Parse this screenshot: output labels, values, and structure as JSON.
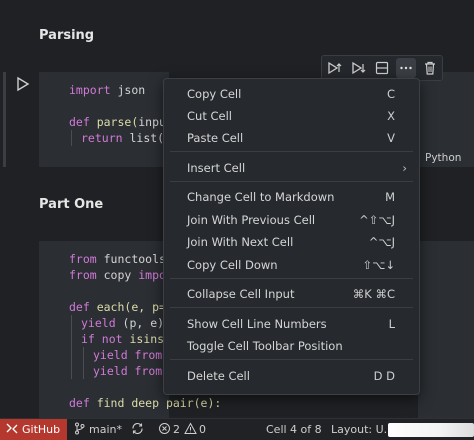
{
  "sections": {
    "parsing_title": "Parsing",
    "part_one_title": "Part One"
  },
  "cell1": {
    "lines": [
      {
        "kw": "import",
        "rest": " json"
      },
      {
        "kw": "def",
        "fn": " parse(",
        "rest": "input"
      },
      {
        "kw": "return",
        "rest": " list(m"
      }
    ],
    "language": "Python"
  },
  "cell2": {
    "lines": [
      {
        "kw": "from",
        "rest": " functools"
      },
      {
        "kw": "from",
        "rest": " copy ",
        "kw2": "impor"
      },
      {
        "kw": "def",
        "rest": " each(e, p=("
      },
      {
        "kw": "yield",
        "rest": " (p, e)"
      },
      {
        "kw": "if not",
        "rest": " isinst"
      },
      {
        "kw": "yield from",
        "rest": " "
      },
      {
        "kw": "yield from",
        "rest": " "
      },
      {
        "kw": "def",
        "rest": " find_deep_pair(e):"
      }
    ]
  },
  "menu": {
    "items": [
      {
        "label": "Copy Cell",
        "key": "C"
      },
      {
        "label": "Cut Cell",
        "key": "X"
      },
      {
        "label": "Paste Cell",
        "key": "V"
      },
      {
        "label": "Insert Cell",
        "key": "›"
      },
      {
        "label": "Change Cell to Markdown",
        "key": "M"
      },
      {
        "label": "Join With Previous Cell",
        "key": "^⇧⌥J"
      },
      {
        "label": "Join With Next Cell",
        "key": "^⌥J"
      },
      {
        "label": "Copy Cell Down",
        "key": "⇧⌥↓"
      },
      {
        "label": "Collapse Cell Input",
        "key": "⌘K ⌘C"
      },
      {
        "label": "Show Cell Line Numbers",
        "key": "L"
      },
      {
        "label": "Toggle Cell Toolbar Position",
        "key": ""
      },
      {
        "label": "Delete Cell",
        "key": "D D"
      }
    ]
  },
  "statusbar": {
    "remote": "GitHub",
    "branch": "main*",
    "problems": "2",
    "warnings": "0",
    "cell_position": "Cell 4 of 8",
    "layout": "Layout: U.S."
  },
  "colors": {
    "remote_bg": "#b5382f",
    "keyword": "#d17ad8",
    "background": "#1f2124"
  }
}
